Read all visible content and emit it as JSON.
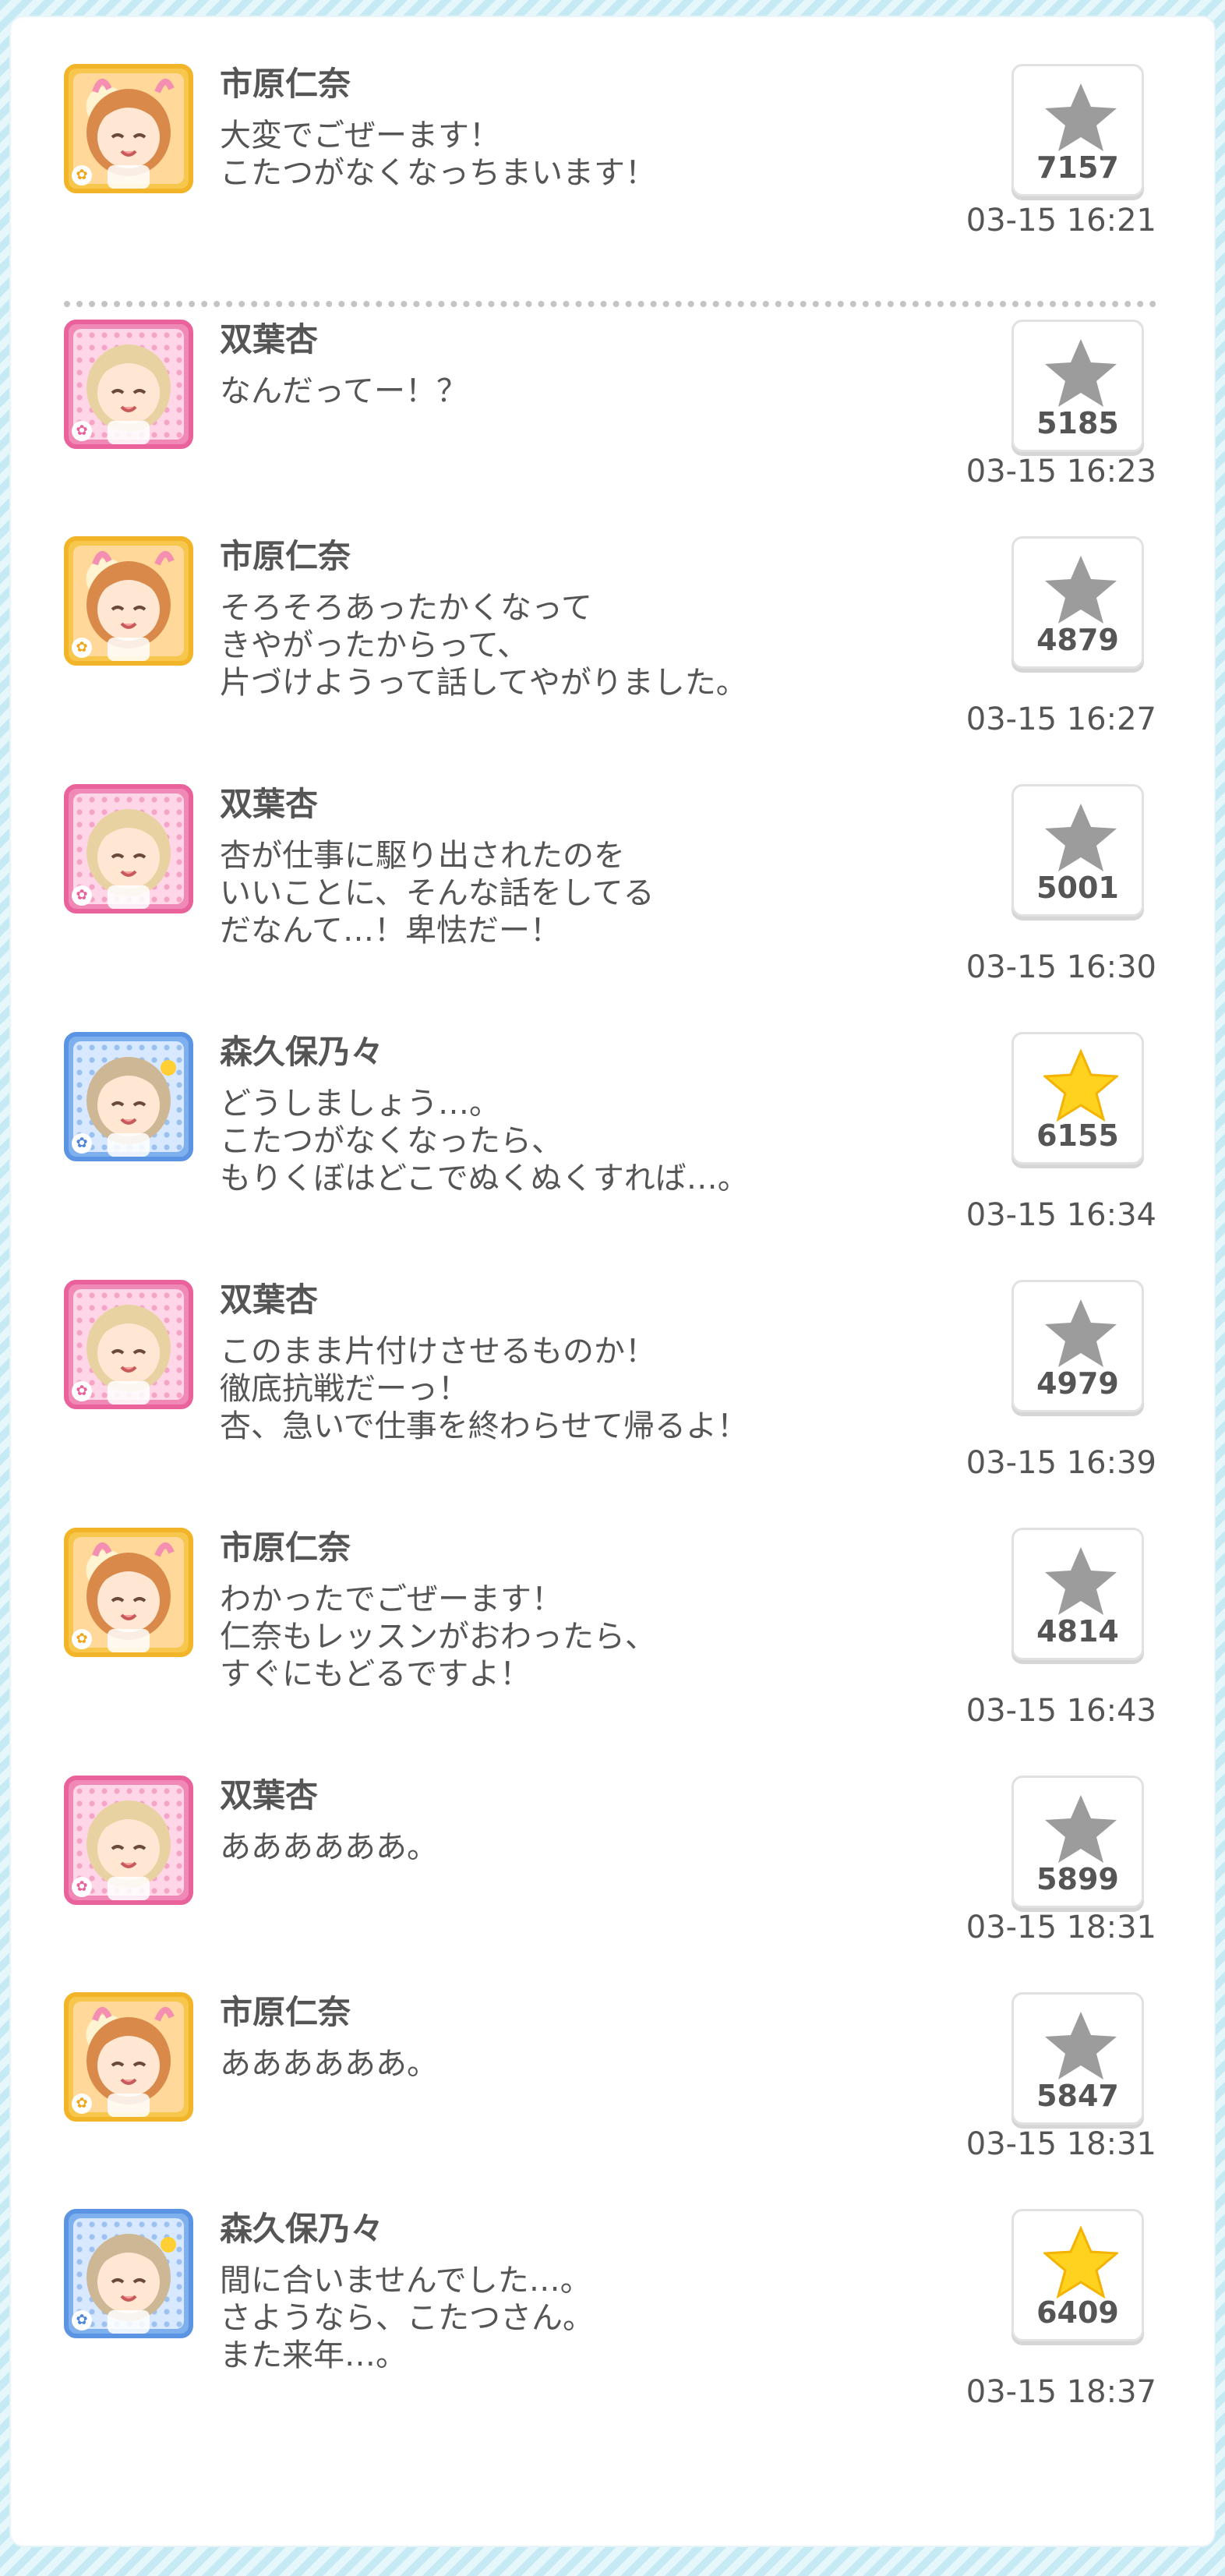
{
  "messages": [
    {
      "character": "nina",
      "name": "市原仁奈",
      "text": "大変でごぜーます！\nこたつがなくなっちまいます！",
      "likes": "7157",
      "liked": false,
      "time": "03-15 16:21"
    },
    {
      "character": "anzu",
      "name": "双葉杏",
      "text": "なんだってー！？",
      "likes": "5185",
      "liked": false,
      "time": "03-15 16:23"
    },
    {
      "character": "nina",
      "name": "市原仁奈",
      "text": "そろそろあったかくなって\nきやがったからって、\n片づけようって話してやがりました。",
      "likes": "4879",
      "liked": false,
      "time": "03-15 16:27"
    },
    {
      "character": "anzu",
      "name": "双葉杏",
      "text": "杏が仕事に駆り出されたのを\nいいことに、そんな話をしてる\nだなんて…！卑怯だー！",
      "likes": "5001",
      "liked": false,
      "time": "03-15 16:30"
    },
    {
      "character": "nonoka",
      "name": "森久保乃々",
      "text": "どうしましょう…。\nこたつがなくなったら、\nもりくぼはどこでぬくぬくすれば…。",
      "likes": "6155",
      "liked": true,
      "time": "03-15 16:34"
    },
    {
      "character": "anzu",
      "name": "双葉杏",
      "text": "このまま片付けさせるものか！\n徹底抗戦だーっ！\n杏、急いで仕事を終わらせて帰るよ！",
      "likes": "4979",
      "liked": false,
      "time": "03-15 16:39"
    },
    {
      "character": "nina",
      "name": "市原仁奈",
      "text": "わかったでごぜーます！\n仁奈もレッスンがおわったら、\nすぐにもどるですよ！",
      "likes": "4814",
      "liked": false,
      "time": "03-15 16:43"
    },
    {
      "character": "anzu",
      "name": "双葉杏",
      "text": "ああああああ。",
      "likes": "5899",
      "liked": false,
      "time": "03-15 18:31"
    },
    {
      "character": "nina",
      "name": "市原仁奈",
      "text": "ああああああ。",
      "likes": "5847",
      "liked": false,
      "time": "03-15 18:31"
    },
    {
      "character": "nonoka",
      "name": "森久保乃々",
      "text": "間に合いませんでした…。\nさようなら、こたつさん。\nまた来年…。",
      "likes": "6409",
      "liked": true,
      "time": "03-15 18:37"
    }
  ],
  "icons": {
    "like": "star-icon",
    "badge": "flower-icon"
  },
  "colors": {
    "text": "#555555",
    "liked_star": "#ffd21f",
    "unliked_star": "#9c9c9c"
  }
}
